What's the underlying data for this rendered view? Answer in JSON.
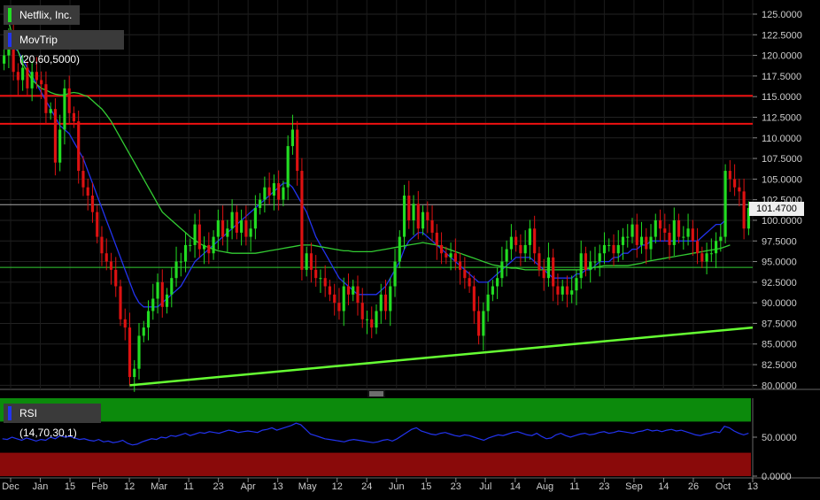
{
  "legend": {
    "ticker": "Netflix, Inc.",
    "ma": "MovTrip (20,60,5000)",
    "rsi": "RSI (14,70,30,1)"
  },
  "last_price_label": "101.4700",
  "colors": {
    "background": "#000000",
    "up": "#22dd22",
    "down": "#dd1111",
    "ma_fast": "#2233ee",
    "ma_slow": "#33cc33",
    "trendline": "#66ff33",
    "resistance": "#ee1111",
    "rsi_line": "#2233ee",
    "rsi_overbought": "#0c8a0c",
    "rsi_oversold": "#8a0a0a"
  },
  "chart_data": [
    {
      "type": "candlestick",
      "title": "Netflix, Inc.",
      "ylim": [
        79.5,
        126.5
      ],
      "yticks": [
        "125.0000",
        "122.5000",
        "120.0000",
        "117.5000",
        "115.0000",
        "112.5000",
        "110.0000",
        "107.5000",
        "105.0000",
        "102.5000",
        "100.0000",
        "97.5000",
        "95.0000",
        "92.5000",
        "90.0000",
        "87.5000",
        "85.0000",
        "82.5000",
        "80.0000"
      ],
      "x_tick_labels": [
        "Dec",
        "Jan",
        "15",
        "Feb",
        "12",
        "Mar",
        "11",
        "23",
        "Apr",
        "13",
        "May",
        "12",
        "24",
        "Jun",
        "15",
        "23",
        "Jul",
        "14",
        "Aug",
        "11",
        "23",
        "Sep",
        "14",
        "26",
        "Oct",
        "13"
      ],
      "close": [
        120,
        122,
        118,
        117,
        118.5,
        116,
        118,
        117,
        116.5,
        113,
        113.5,
        107,
        111,
        116,
        113,
        112,
        106,
        104,
        103,
        101,
        98,
        96,
        95,
        94,
        92,
        88,
        87,
        81,
        82,
        86,
        87,
        89,
        90.5,
        92.5,
        89.5,
        91,
        93,
        95,
        95,
        97,
        97,
        99.5,
        96.5,
        97,
        96,
        98,
        100,
        98,
        99,
        101,
        98.5,
        100,
        98,
        99,
        101.5,
        102.5,
        104,
        103,
        104.5,
        102.5,
        104,
        109,
        111,
        106,
        94,
        96,
        94,
        93,
        93,
        92,
        91,
        90,
        89,
        92,
        91,
        92,
        90,
        88,
        88,
        87,
        89,
        91,
        89,
        92,
        95,
        98,
        103,
        100,
        102,
        99,
        101,
        100,
        98.5,
        97,
        96,
        95.5,
        96,
        95,
        94,
        93,
        92,
        89,
        86,
        89,
        91,
        92,
        93,
        95,
        96.5,
        98,
        97,
        96,
        97,
        99,
        96,
        94,
        93,
        95.5,
        92,
        91,
        92,
        91,
        91.5,
        93,
        96,
        94,
        95,
        95,
        96,
        97,
        97,
        96,
        97,
        98,
        98,
        99.5,
        97,
        98,
        96.5,
        98,
        100,
        99,
        98.5,
        97,
        100,
        98,
        98,
        99,
        97.5,
        96,
        95,
        96,
        96,
        97.5,
        98,
        106,
        105,
        104,
        103.5,
        99,
        101.5
      ],
      "highs_lows_approx": "wicks extend ~0.5-2 above/below bodies",
      "overlays": [
        {
          "name": "MovTrip fast (20)",
          "values": [
            122,
            121.5,
            121,
            120.5,
            119.5,
            118.5,
            117.5,
            116.5,
            115.5,
            114.5,
            113.5,
            112.5,
            111.5,
            111,
            110.5,
            109.5,
            108.5,
            107.5,
            106,
            104.5,
            103,
            101.5,
            100,
            98.5,
            97,
            95.5,
            94,
            92.5,
            91,
            90,
            89.5,
            89.5,
            89.5,
            89.5,
            90,
            90.5,
            91,
            91.5,
            92,
            93,
            94,
            95,
            95.5,
            96,
            96.5,
            97,
            97.5,
            98,
            98.5,
            99,
            99.5,
            100,
            100.5,
            101,
            101.5,
            102,
            102.5,
            103,
            103.5,
            104,
            104.5,
            104.5,
            104,
            103,
            102,
            101,
            99.5,
            98,
            97,
            96,
            95,
            94,
            93,
            92.5,
            92,
            91.5,
            91,
            91,
            91,
            91,
            91,
            91.5,
            92,
            93,
            94,
            95,
            96.5,
            97.5,
            98,
            98.5,
            98.5,
            98,
            97.5,
            97,
            96.5,
            96,
            95.5,
            95,
            94.5,
            94,
            93.5,
            93,
            92.5,
            92.5,
            92.5,
            93,
            93.5,
            94,
            94.5,
            95,
            95.5,
            95.5,
            95.5,
            95.5,
            95,
            94.5,
            94,
            93.5,
            93,
            93,
            93,
            93,
            93,
            93.5,
            93.5,
            94,
            94,
            94.5,
            95,
            95,
            95,
            95.5,
            95.5,
            96,
            96,
            96.5,
            96.5,
            97,
            97,
            97.5,
            97.5,
            97.5,
            97.5,
            97.5,
            97.5,
            97.5,
            97.5,
            97.5,
            97.5,
            97.5,
            98,
            98.5,
            99,
            99.5,
            99.5,
            100
          ]
        },
        {
          "name": "MovTrip slow (60)",
          "values": [
            126,
            124,
            122,
            120.5,
            119,
            118,
            117,
            116.5,
            116,
            115.8,
            115.5,
            115.3,
            115.2,
            115.2,
            115.4,
            115.5,
            115.4,
            115.2,
            115,
            114.5,
            114,
            113.5,
            112.8,
            112,
            111,
            110,
            109,
            108,
            107,
            106,
            105,
            104,
            103,
            102,
            101,
            100.5,
            100,
            99.5,
            99,
            98.5,
            98,
            97.6,
            97.2,
            96.9,
            96.7,
            96.5,
            96.3,
            96.2,
            96.1,
            96,
            96,
            96,
            96,
            96,
            96,
            96.1,
            96.2,
            96.3,
            96.4,
            96.5,
            96.6,
            96.7,
            96.8,
            96.9,
            97,
            97,
            97,
            96.9,
            96.8,
            96.7,
            96.6,
            96.5,
            96.4,
            96.3,
            96.3,
            96.2,
            96.2,
            96.2,
            96.2,
            96.2,
            96.3,
            96.4,
            96.5,
            96.6,
            96.7,
            96.8,
            96.9,
            97,
            97.1,
            97.2,
            97.3,
            97.2,
            97.1,
            97,
            96.8,
            96.6,
            96.4,
            96.2,
            96,
            95.8,
            95.6,
            95.4,
            95.2,
            95,
            94.8,
            94.6,
            94.5,
            94.4,
            94.3,
            94.2,
            94.2,
            94.1,
            94,
            94,
            94,
            94,
            94,
            94,
            94,
            94,
            94,
            94,
            94,
            94,
            94,
            94.1,
            94.2,
            94.3,
            94.4,
            94.5,
            94.5,
            94.5,
            94.5,
            94.5,
            94.5,
            94.6,
            94.7,
            94.8,
            95,
            95.1,
            95.2,
            95.3,
            95.4,
            95.5,
            95.6,
            95.7,
            95.8,
            95.9,
            96,
            96.1,
            96.2,
            96.3,
            96.4,
            96.5,
            96.6,
            96.8,
            97
          ]
        }
      ],
      "horizontal_lines": [
        {
          "name": "resistance-upper",
          "value": 115.1
        },
        {
          "name": "resistance-lower",
          "value": 111.7
        },
        {
          "name": "reference-102",
          "value": 101.9
        },
        {
          "name": "reference-94",
          "value": 94.3
        }
      ],
      "trendline": {
        "from": {
          "index": 27,
          "value": 80.0
        },
        "to": {
          "index": 155,
          "value": 87.0
        }
      }
    },
    {
      "type": "line",
      "title": "RSI (14,70,30,1)",
      "ylim": [
        0,
        100
      ],
      "yticks": [
        "50.0000",
        "0.0000"
      ],
      "bands": {
        "overbought_from": 70,
        "oversold_to": 30
      },
      "values": [
        48,
        47,
        50,
        48,
        46,
        49,
        47,
        45,
        47,
        46,
        50,
        48,
        52,
        50,
        51,
        49,
        47,
        48,
        46,
        45,
        47,
        44,
        45,
        43,
        44,
        46,
        42,
        40,
        41,
        44,
        46,
        48,
        47,
        50,
        49,
        52,
        51,
        53,
        55,
        52,
        54,
        56,
        55,
        57,
        56,
        55,
        57,
        59,
        58,
        56,
        57,
        58,
        57,
        56,
        59,
        60,
        62,
        59,
        61,
        63,
        65,
        68,
        66,
        60,
        54,
        52,
        50,
        48,
        47,
        46,
        45,
        44,
        46,
        47,
        46,
        45,
        44,
        43,
        44,
        46,
        47,
        45,
        48,
        52,
        56,
        60,
        62,
        58,
        56,
        54,
        53,
        55,
        56,
        54,
        52,
        51,
        53,
        52,
        50,
        48,
        46,
        49,
        51,
        53,
        52,
        54,
        56,
        57,
        55,
        53,
        52,
        55,
        51,
        48,
        49,
        53,
        55,
        52,
        50,
        52,
        54,
        55,
        53,
        54,
        56,
        57,
        55,
        56,
        58,
        57,
        56,
        55,
        57,
        58,
        60,
        58,
        59,
        57,
        59,
        60,
        58,
        59,
        57,
        55,
        53,
        52,
        54,
        55,
        57,
        56,
        64,
        62,
        58,
        55,
        53,
        55
      ]
    }
  ]
}
